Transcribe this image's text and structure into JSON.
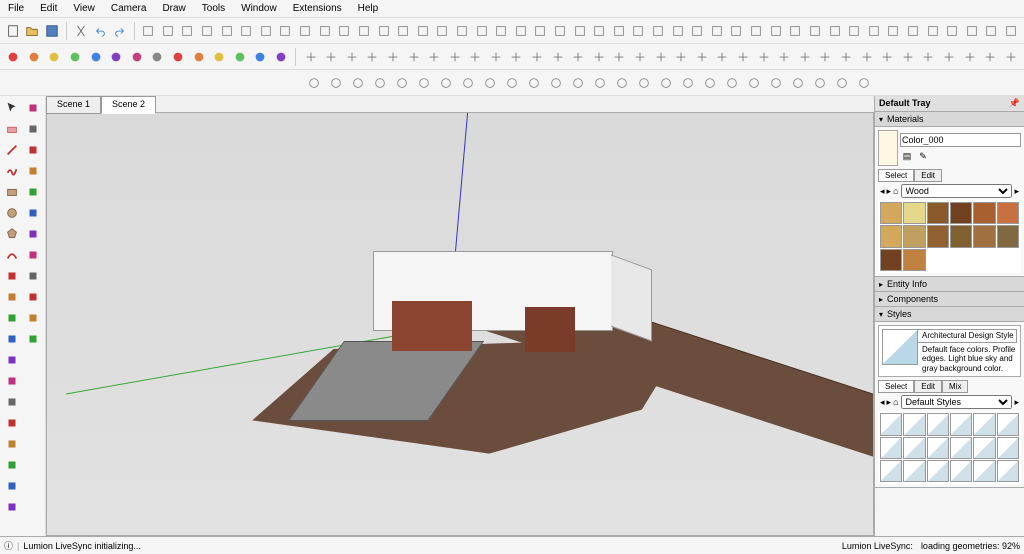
{
  "menu": [
    "File",
    "Edit",
    "View",
    "Camera",
    "Draw",
    "Tools",
    "Window",
    "Extensions",
    "Help"
  ],
  "scenes": {
    "tabs": [
      "Scene 1",
      "Scene 2"
    ],
    "active": 1
  },
  "tray": {
    "title": "Default Tray",
    "materials": {
      "title": "Materials",
      "current_name": "Color_000",
      "tabs": [
        "Select",
        "Edit"
      ],
      "library": "Wood",
      "swatches": [
        "#d4a85a",
        "#e6d88a",
        "#8b5a2b",
        "#704020",
        "#a86030",
        "#c87040",
        "#d4a85a",
        "#c0a060",
        "#906030",
        "#806030",
        "#a07040",
        "#806840",
        "#704020",
        "#c08040"
      ]
    },
    "panels": {
      "entity": "Entity Info",
      "components": "Components",
      "styles": "Styles"
    },
    "styles": {
      "current_name": "Architectural Design Style",
      "description": "Default face colors. Profile edges. Light blue sky and gray background color.",
      "tabs": [
        "Select",
        "Edit",
        "Mix"
      ],
      "library": "Default Styles"
    }
  },
  "status": {
    "left": "Lumion LiveSync initializing...",
    "right_label": "Lumion LiveSync:",
    "right_value": "loading geometries: 92%"
  }
}
